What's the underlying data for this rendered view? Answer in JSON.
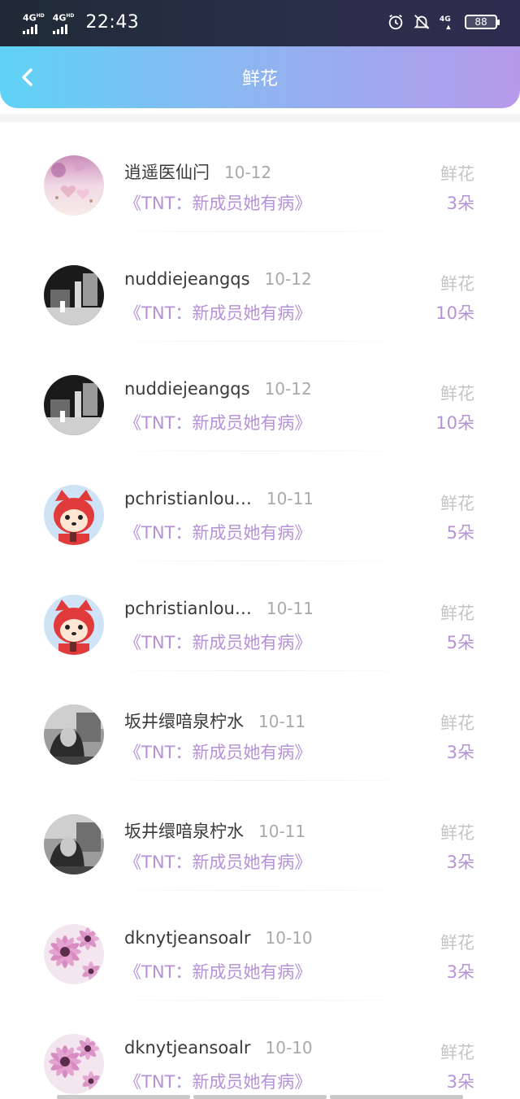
{
  "status_bar": {
    "network1": "4G",
    "network1_sup": "HD",
    "network2": "4G",
    "network2_sup": "HD",
    "time": "22:43",
    "net_small": "4G",
    "battery": "88"
  },
  "header": {
    "title": "鲜花"
  },
  "records": [
    {
      "name": "逍遥医仙闩",
      "date": "10-12",
      "work": "《TNT：新成员她有病》",
      "type": "鲜花",
      "count": "3朵",
      "avatar": "pink-heart"
    },
    {
      "name": "nuddiejeangqs",
      "date": "10-12",
      "work": "《TNT：新成员她有病》",
      "type": "鲜花",
      "count": "10朵",
      "avatar": "bw-dark"
    },
    {
      "name": "nuddiejeangqs",
      "date": "10-12",
      "work": "《TNT：新成员她有病》",
      "type": "鲜花",
      "count": "10朵",
      "avatar": "bw-dark"
    },
    {
      "name": "pchristianlou…",
      "date": "10-11",
      "work": "《TNT：新成员她有病》",
      "type": "鲜花",
      "count": "5朵",
      "avatar": "red-fox"
    },
    {
      "name": "pchristianlou…",
      "date": "10-11",
      "work": "《TNT：新成员她有病》",
      "type": "鲜花",
      "count": "5朵",
      "avatar": "red-fox"
    },
    {
      "name": "坂井缳喑泉柠水",
      "date": "10-11",
      "work": "《TNT：新成员她有病》",
      "type": "鲜花",
      "count": "3朵",
      "avatar": "bw-girl"
    },
    {
      "name": "坂井缳喑泉柠水",
      "date": "10-11",
      "work": "《TNT：新成员她有病》",
      "type": "鲜花",
      "count": "3朵",
      "avatar": "bw-girl"
    },
    {
      "name": "dknytjeansoalr",
      "date": "10-10",
      "work": "《TNT：新成员她有病》",
      "type": "鲜花",
      "count": "3朵",
      "avatar": "daisy"
    },
    {
      "name": "dknytjeansoalr",
      "date": "10-10",
      "work": "《TNT：新成员她有病》",
      "type": "鲜花",
      "count": "3朵",
      "avatar": "daisy"
    }
  ],
  "colors": {
    "accent": "#b592d6",
    "header_start": "#5fd3f5",
    "header_end": "#b69aea",
    "muted": "#c4c4c4"
  }
}
